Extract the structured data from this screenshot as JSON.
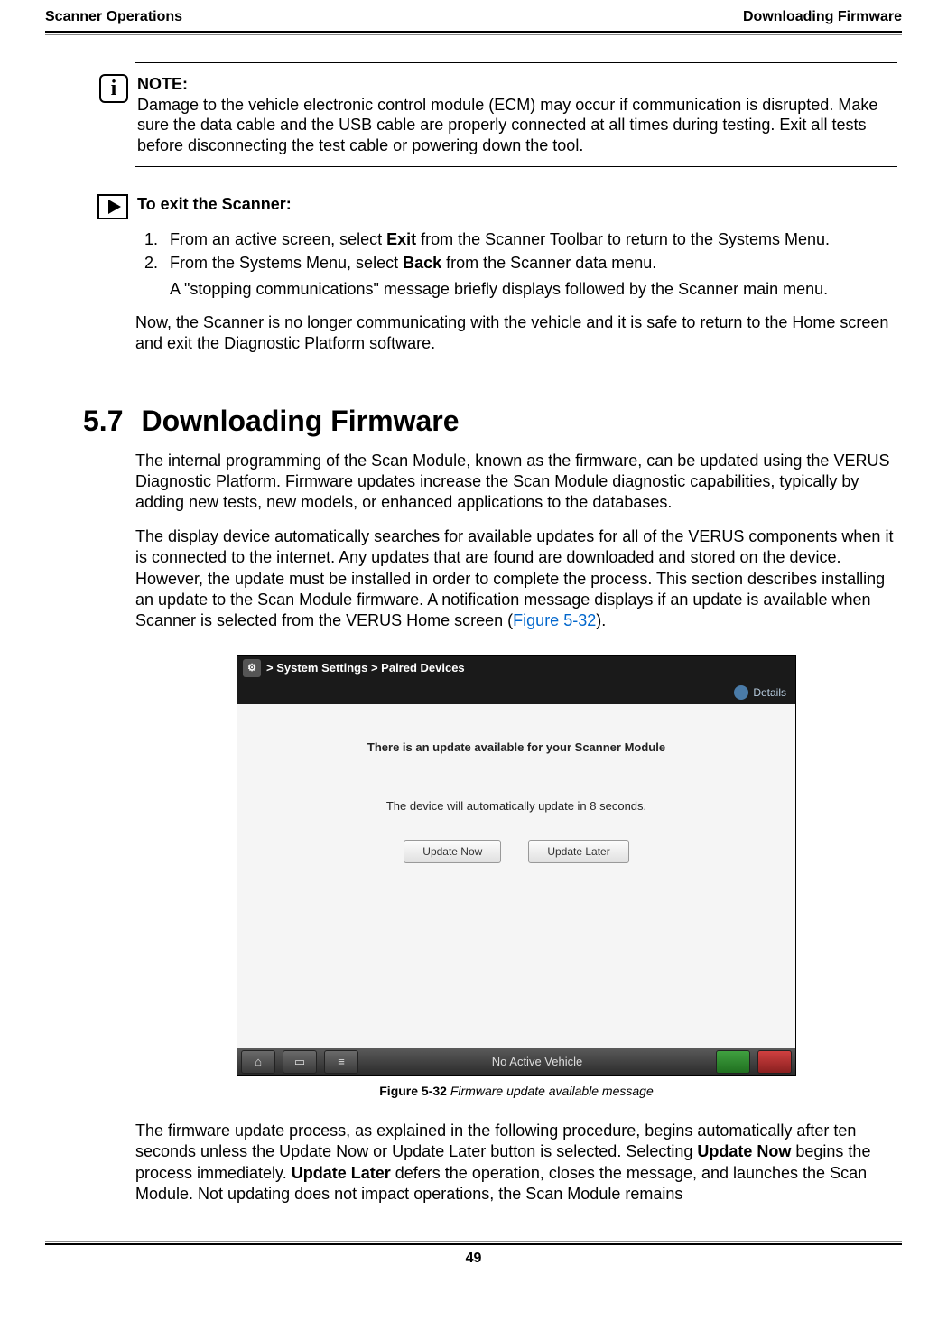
{
  "header": {
    "left": "Scanner Operations",
    "right": "Downloading Firmware"
  },
  "note": {
    "label": "NOTE:",
    "text": "Damage to the vehicle electronic control module (ECM) may occur if communication is disrupted. Make sure the data cable and the USB cable are properly connected at all times during testing. Exit all tests before disconnecting the test cable or powering down the tool."
  },
  "exit": {
    "heading": "To exit the Scanner:",
    "step1_a": "From an active screen, select ",
    "step1_bold": "Exit",
    "step1_b": " from the Scanner Toolbar to return to the Systems Menu.",
    "step2_a": "From the Systems Menu, select ",
    "step2_bold": "Back",
    "step2_b": " from the Scanner data menu.",
    "step2_sub": "A \"stopping communications\" message briefly displays followed by the Scanner main menu.",
    "closing": "Now, the Scanner is no longer communicating with the vehicle and it is safe to return to the Home screen and exit the Diagnostic Platform software."
  },
  "section": {
    "number": "5.7",
    "title": "Downloading Firmware",
    "p1": "The internal programming of the Scan Module, known as the firmware, can be updated using the VERUS Diagnostic Platform. Firmware updates increase the Scan Module diagnostic capabilities, typically by adding new tests, new models, or enhanced applications to the databases.",
    "p2_a": "The display device automatically searches for available updates for all of the VERUS components when it is connected to the internet. Any updates that are found are downloaded and stored on the device. However, the update must be installed in order to complete the process. This section describes installing an update to the Scan Module firmware. A notification message displays if an update is available when Scanner is selected from the VERUS Home screen (",
    "p2_link": "Figure 5-32",
    "p2_b": ").",
    "p3_a": "The firmware update process, as explained in the following procedure, begins automatically after ten seconds unless the Update Now or Update Later button is selected. Selecting ",
    "p3_bold1": "Update Now",
    "p3_b": " begins the process immediately. ",
    "p3_bold2": "Update Later",
    "p3_c": " defers the operation, closes the message, and launches the Scan Module. Not updating does not impact operations, the Scan Module remains"
  },
  "figure": {
    "titlebar": "> System Settings   > Paired Devices",
    "details": "Details",
    "msg1": "There is an update available for your Scanner Module",
    "msg2": "The device will automatically update in 8 seconds.",
    "btn1": "Update Now",
    "btn2": "Update Later",
    "statusbar": "No Active Vehicle",
    "caption_label": "Figure 5-32",
    "caption_text": " Firmware update available message"
  },
  "footer": {
    "page": "49"
  }
}
